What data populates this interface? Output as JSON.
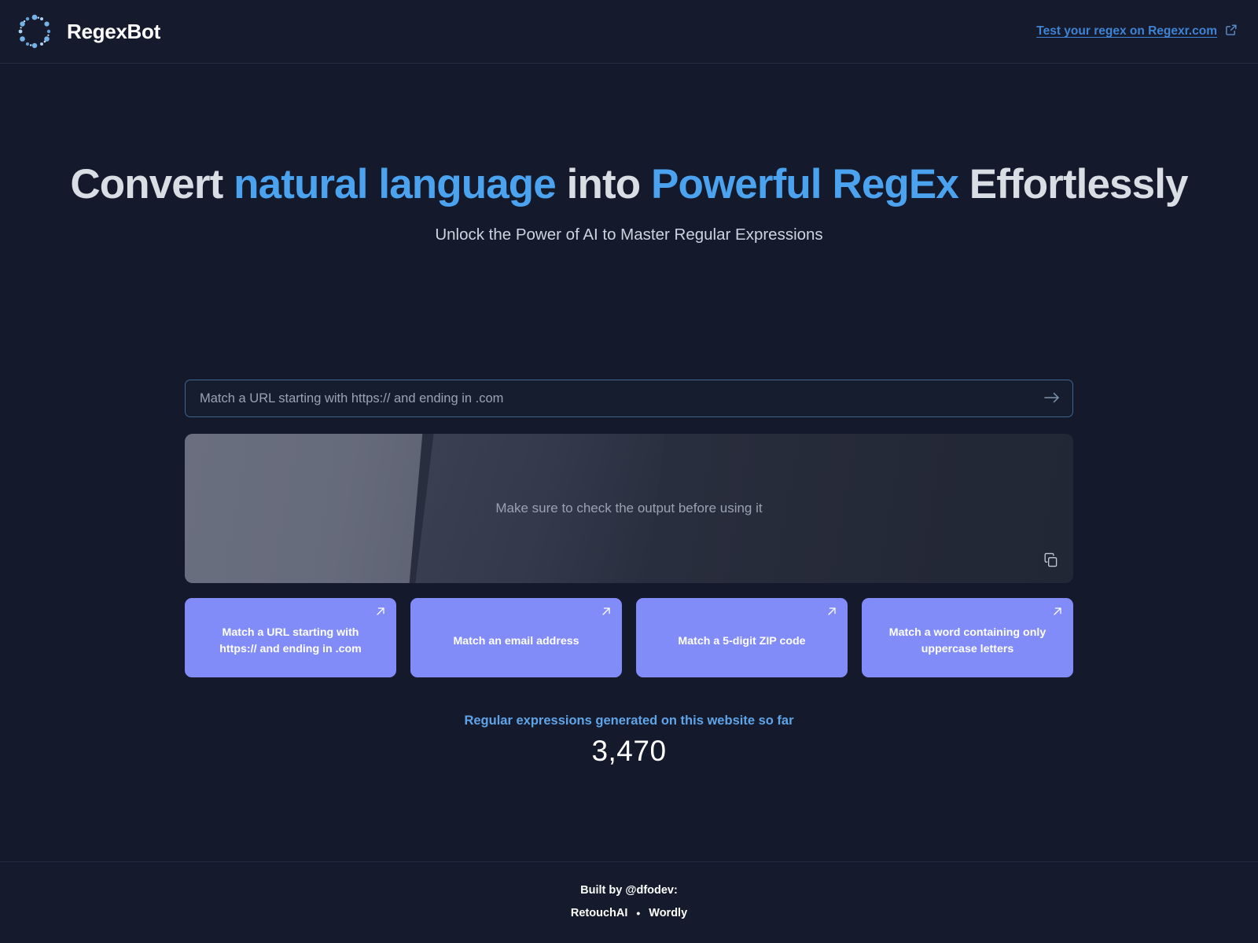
{
  "header": {
    "brand_name": "RegexBot",
    "logo_icon": "dotted-ring-logo",
    "link_label": "Test your regex on Regexr.com",
    "link_icon": "external-link-icon"
  },
  "hero": {
    "headline_part1": "Convert ",
    "headline_accent1": "natural language",
    "headline_part2": " into ",
    "headline_accent2": "Powerful RegEx",
    "headline_part3": " Effortlessly",
    "subtitle": "Unlock the Power of AI to Master Regular Expressions"
  },
  "converter": {
    "input_placeholder": "Match a URL starting with https:// and ending in .com",
    "input_value": "",
    "submit_icon": "arrow-right-icon",
    "output_message": "Make sure to check the output before using it",
    "copy_icon": "copy-icon"
  },
  "suggestions": [
    {
      "label": "Match a URL starting with https:// and ending in .com",
      "icon": "arrow-up-right-icon"
    },
    {
      "label": "Match an email address",
      "icon": "arrow-up-right-icon"
    },
    {
      "label": "Match a 5-digit ZIP code",
      "icon": "arrow-up-right-icon"
    },
    {
      "label": "Match a word containing only uppercase letters",
      "icon": "arrow-up-right-icon"
    }
  ],
  "counter": {
    "label": "Regular expressions generated on this website so far",
    "value": "3,470"
  },
  "footer": {
    "built_by": "Built by @dfodev:",
    "project1": "RetouchAI",
    "separator": "•",
    "project2": "Wordly"
  },
  "colors": {
    "page_bg": "#141a2b",
    "header_bg": "#151b2c",
    "accent_blue": "#4ba3f0",
    "link_blue": "#3f83d4",
    "card_purple": "#818cf8",
    "counter_blue": "#5fa4e8",
    "border": "#252c40"
  }
}
